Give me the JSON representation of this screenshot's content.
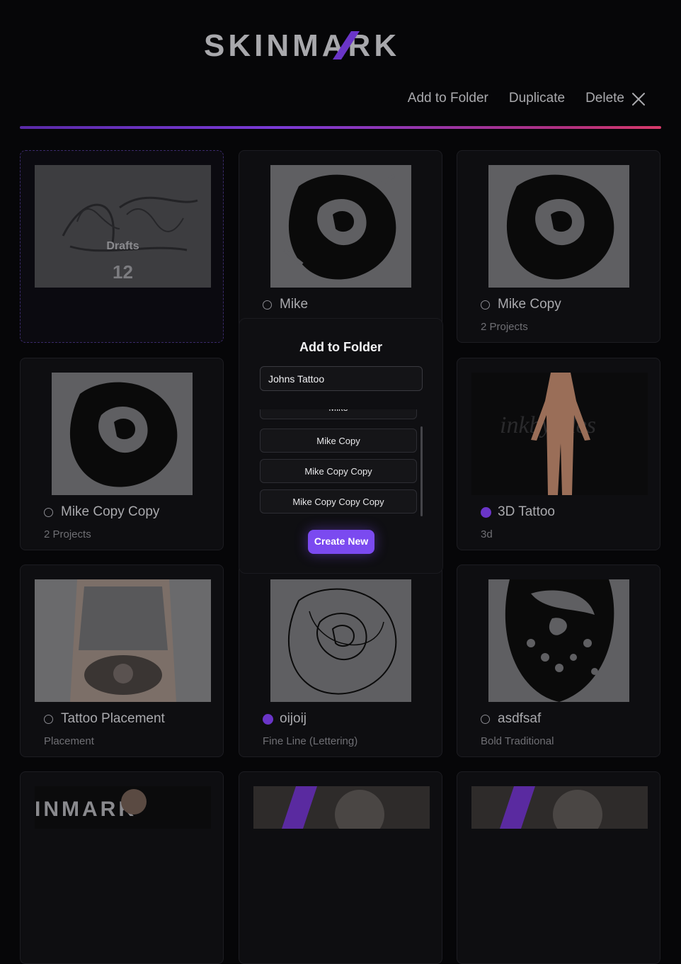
{
  "brand": {
    "logo_text": "SKINMARK"
  },
  "toolbar": {
    "add_to_folder": "Add to Folder",
    "duplicate": "Duplicate",
    "delete": "Delete"
  },
  "drafts": {
    "label": "Drafts",
    "count": "12"
  },
  "cards": [
    {
      "title": "Mike",
      "subtitle": "",
      "selected": false
    },
    {
      "title": "Mike Copy",
      "subtitle": "2 Projects",
      "selected": false
    },
    {
      "title": "Mike Copy Copy",
      "subtitle": "2 Projects",
      "selected": false
    },
    {
      "title": "3D Tattoo",
      "subtitle": "3d",
      "selected": true
    },
    {
      "title": "Tattoo Placement",
      "subtitle": "Placement",
      "selected": false
    },
    {
      "title": "oijoij",
      "subtitle": "Fine Line (Lettering)",
      "selected": true
    },
    {
      "title": "asdfsaf",
      "subtitle": "Bold Traditional",
      "selected": false
    }
  ],
  "modal": {
    "title": "Add to Folder",
    "input_value": "Johns Tattoo",
    "folders": [
      "Mike",
      "Mike Copy",
      "Mike Copy Copy",
      "Mike Copy Copy Copy"
    ],
    "create_label": "Create New"
  },
  "colors": {
    "accent": "#7b4af0",
    "selected_dot": "#6a35c8"
  }
}
